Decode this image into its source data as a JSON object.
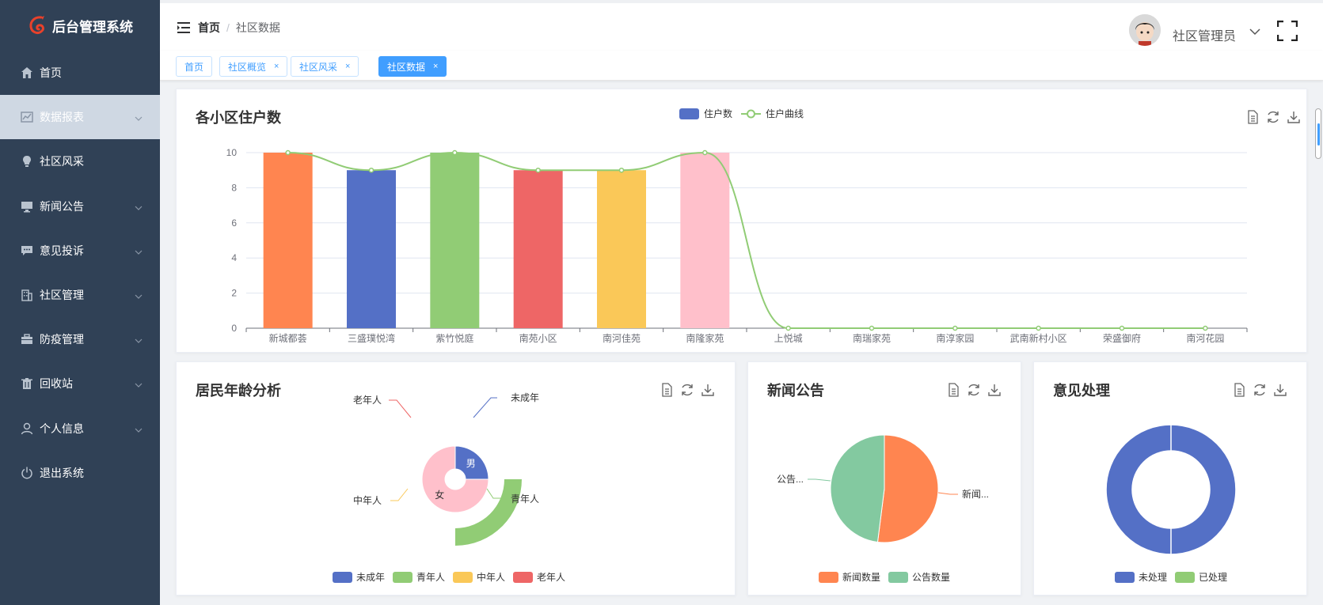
{
  "app": {
    "title": "后台管理系统"
  },
  "sidebar": {
    "items": [
      {
        "label": "首页",
        "icon": "home-icon",
        "expandable": false,
        "active": false
      },
      {
        "label": "数据报表",
        "icon": "chart-icon",
        "expandable": true,
        "active": true
      },
      {
        "label": "社区风采",
        "icon": "bulb-icon",
        "expandable": false,
        "active": false
      },
      {
        "label": "新闻公告",
        "icon": "monitor-icon",
        "expandable": true,
        "active": false
      },
      {
        "label": "意见投诉",
        "icon": "message-icon",
        "expandable": true,
        "active": false
      },
      {
        "label": "社区管理",
        "icon": "building-icon",
        "expandable": true,
        "active": false
      },
      {
        "label": "防疫管理",
        "icon": "briefcase-icon",
        "expandable": true,
        "active": false
      },
      {
        "label": "回收站",
        "icon": "trash-icon",
        "expandable": true,
        "active": false
      },
      {
        "label": "个人信息",
        "icon": "user-icon",
        "expandable": true,
        "active": false
      },
      {
        "label": "退出系统",
        "icon": "power-icon",
        "expandable": false,
        "active": false
      }
    ]
  },
  "header": {
    "breadcrumb": {
      "home": "首页",
      "separator": "/",
      "current": "社区数据"
    },
    "username": "社区管理员"
  },
  "tags": [
    {
      "label": "首页",
      "closable": false,
      "active": false
    },
    {
      "label": "社区概览",
      "closable": true,
      "active": false
    },
    {
      "label": "社区风采",
      "closable": true,
      "active": false
    },
    {
      "label": "社区数据",
      "closable": true,
      "active": true
    }
  ],
  "close_glyph": "×",
  "colors": {
    "sidebar_bg": "#304156",
    "accent": "#409eff",
    "blue": "#5470c6",
    "green": "#91cc75",
    "yellow": "#fac858",
    "red": "#ee6666",
    "orange": "#ff8550",
    "pink": "#ffc0cb",
    "teal": "#83c9a0"
  },
  "cards": {
    "households": {
      "title": "各小区住户数"
    },
    "age": {
      "title": "居民年龄分析"
    },
    "news": {
      "title": "新闻公告"
    },
    "feedback": {
      "title": "意见处理"
    }
  },
  "chart_data": [
    {
      "id": "households",
      "type": "bar",
      "title": "各小区住户数",
      "categories": [
        "新城都荟",
        "三盛璞悦湾",
        "紫竹悦庭",
        "南苑小区",
        "南河佳苑",
        "南隆家苑",
        "上悦城",
        "南瑞家苑",
        "南淳家园",
        "武南新村小区",
        "荣盛御府",
        "南河花园"
      ],
      "series": [
        {
          "name": "住户数",
          "type": "bar",
          "values": [
            10,
            9,
            10,
            9,
            9,
            10,
            0,
            0,
            0,
            0,
            0,
            0
          ]
        },
        {
          "name": "住户曲线",
          "type": "line",
          "values": [
            10,
            9,
            10,
            9,
            9,
            10,
            0,
            0,
            0,
            0,
            0,
            0
          ]
        }
      ],
      "bar_colors": [
        "#ff8550",
        "#5470c6",
        "#91cc75",
        "#ee6666",
        "#fac858",
        "#ffc0cb"
      ],
      "yticks": [
        0,
        2,
        4,
        6,
        8,
        10
      ],
      "ylim": [
        0,
        10
      ],
      "legend": "top-center",
      "grid": true
    },
    {
      "id": "age",
      "type": "pie",
      "title": "居民年龄分析",
      "inner": {
        "slices": [
          {
            "name": "男",
            "value": 1
          },
          {
            "name": "女",
            "value": 3
          }
        ]
      },
      "outer": {
        "slices": [
          {
            "name": "未成年",
            "value": 0
          },
          {
            "name": "青年人",
            "value": 1
          },
          {
            "name": "中年人",
            "value": 0
          },
          {
            "name": "老年人",
            "value": 0
          }
        ]
      },
      "legend": [
        "未成年",
        "青年人",
        "中年人",
        "老年人"
      ],
      "legend_position": "bottom"
    },
    {
      "id": "news",
      "type": "pie",
      "title": "新闻公告",
      "slices": [
        {
          "name": "新闻数量",
          "label": "新闻...",
          "value": 52
        },
        {
          "name": "公告数量",
          "label": "公告...",
          "value": 48
        }
      ],
      "legend": [
        "新闻数量",
        "公告数量"
      ],
      "legend_position": "bottom"
    },
    {
      "id": "feedback",
      "type": "pie",
      "title": "意见处理",
      "slices": [
        {
          "name": "未处理",
          "value": 1
        },
        {
          "name": "已处理",
          "value": 0
        }
      ],
      "legend": [
        "未处理",
        "已处理"
      ],
      "legend_position": "bottom"
    }
  ]
}
